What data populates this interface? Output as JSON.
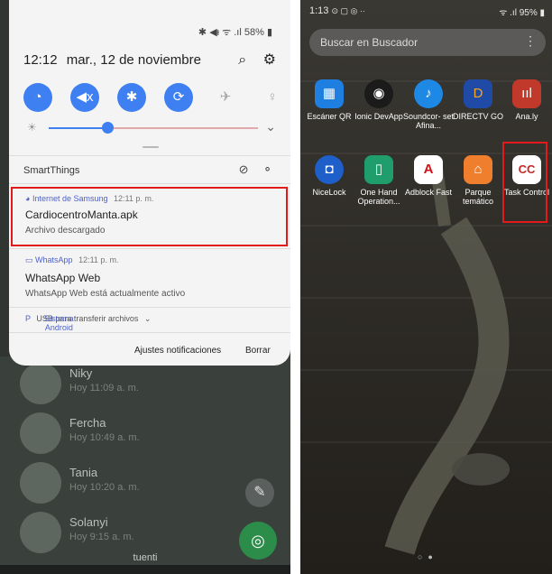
{
  "left_phone": {
    "status_icons": "✱ ◀ᵻ ᯤ .ıl 58% ▮",
    "quick_settings": {
      "time": "12:12",
      "date": "mar., 12 de noviembre",
      "search_icon": "⌕",
      "gear_icon": "⚙",
      "tiles": [
        {
          "name": "wifi",
          "state": "on",
          "glyph": "◔"
        },
        {
          "name": "mute",
          "state": "on",
          "glyph": "◀x"
        },
        {
          "name": "bluetooth",
          "state": "on",
          "glyph": "✱"
        },
        {
          "name": "rotate",
          "state": "on",
          "glyph": "⟳"
        },
        {
          "name": "airplane",
          "state": "off",
          "glyph": "✈"
        },
        {
          "name": "flashlight",
          "state": "off",
          "glyph": "♀"
        }
      ],
      "brightness": 0.28,
      "chevron": "⌄"
    },
    "smartthings": {
      "label": "SmartThings",
      "icons": [
        "⊘",
        "⚬"
      ]
    },
    "notifications": [
      {
        "app": "Internet de Samsung",
        "time": "12:11 p. m.",
        "title": "CardiocentroManta.apk",
        "text": "Archivo descargado"
      },
      {
        "app": "WhatsApp",
        "time": "12:11 p. m.",
        "title": "WhatsApp Web",
        "text": "WhatsApp Web está actualmente activo"
      }
    ],
    "android": {
      "app": "Sistema Android",
      "text": "USB para transferir archivos"
    },
    "buttons": {
      "settings": "Ajustes notificaciones",
      "clear": "Borrar"
    },
    "chats": [
      {
        "name": "Niky",
        "time": "Hoy 11:09 a. m."
      },
      {
        "name": "Fercha",
        "time": "Hoy 10:49 a. m."
      },
      {
        "name": "Tania",
        "time": "Hoy 10:20 a. m."
      },
      {
        "name": "Solanyi",
        "time": "Hoy 9:15 a. m."
      }
    ],
    "bottom_label": "tuenti",
    "colors": {
      "accent": "#3e7ff1",
      "highlight": "#e4191b",
      "fab": "#2c8c4a"
    }
  },
  "right_phone": {
    "status_left": "1:13",
    "status_right": "95%",
    "search_placeholder": "Buscar en Buscador",
    "apps": [
      {
        "label": "Escáner QR",
        "color": "#1e7fe0",
        "glyph": "▦"
      },
      {
        "label": "Ionic DevApp",
        "color": "#1b1b1b",
        "glyph": "◉"
      },
      {
        "label": "Soundcor- set Afina...",
        "color": "#1e88e5",
        "glyph": "♪"
      },
      {
        "label": "DIRECTV GO",
        "color": "#1f4aa5",
        "glyph": "D"
      },
      {
        "label": "Ana.ly",
        "color": "#c0392b",
        "glyph": "ııl"
      },
      {
        "label": "NiceLock",
        "color": "#1f5fc9",
        "glyph": "◘"
      },
      {
        "label": "One Hand Operation...",
        "color": "#1f9d6a",
        "glyph": "▯"
      },
      {
        "label": "Adblock Fast",
        "color": "#ffffff",
        "glyph": "A"
      },
      {
        "label": "Parque temático",
        "color": "#ef7f2c",
        "glyph": "⌂"
      },
      {
        "label": "Task Control",
        "color": "#ffffff",
        "glyph": "CC"
      }
    ]
  }
}
